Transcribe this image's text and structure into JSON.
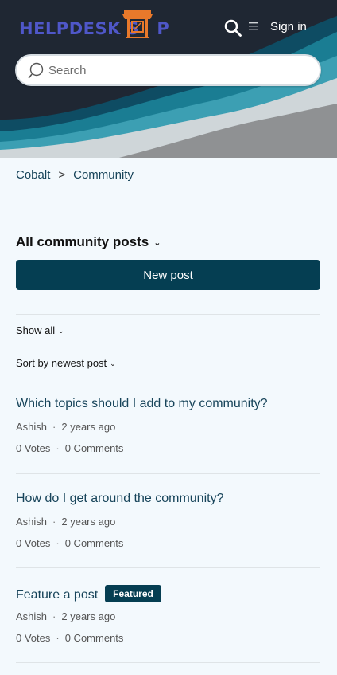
{
  "header": {
    "logo_text_before": "HELPDESK S",
    "logo_text_after": "P",
    "search_icon": "search-icon",
    "menu_icon": "menu-icon",
    "sign_in": "Sign in"
  },
  "search": {
    "placeholder": "Search"
  },
  "breadcrumb": {
    "items": [
      "Cobalt",
      "Community"
    ],
    "separator": ">"
  },
  "main": {
    "heading": "All community posts",
    "new_post_label": "New post",
    "filters": {
      "show": "Show all",
      "sort": "Sort by newest post"
    },
    "posts": [
      {
        "title": "Which topics should I add to my community?",
        "author": "Ashish",
        "time": "2 years ago",
        "votes": "0 Votes",
        "comments": "0 Comments",
        "badge": ""
      },
      {
        "title": "How do I get around the community?",
        "author": "Ashish",
        "time": "2 years ago",
        "votes": "0 Votes",
        "comments": "0 Comments",
        "badge": ""
      },
      {
        "title": "Feature a post",
        "author": "Ashish",
        "time": "2 years ago",
        "votes": "0 Votes",
        "comments": "0 Comments",
        "badge": "Featured"
      }
    ],
    "meta_separator": "·"
  },
  "colors": {
    "brand": "#053e52",
    "link": "#17445a",
    "logo": "#4f57c9",
    "logo_icon": "#e8792b",
    "hero_bg": "#1f2733"
  }
}
